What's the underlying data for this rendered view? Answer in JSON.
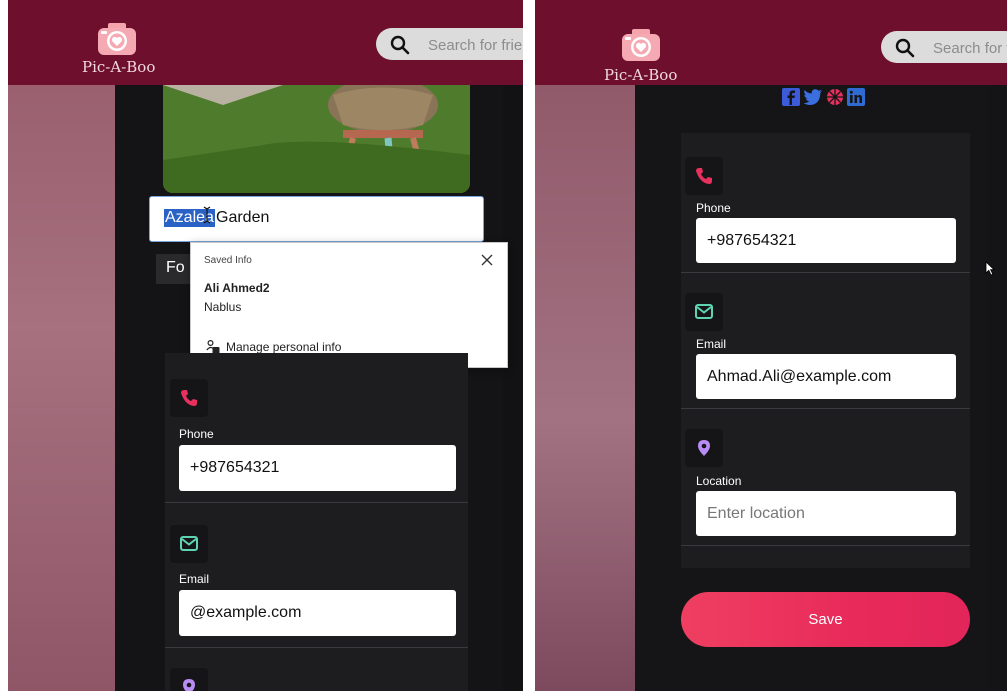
{
  "app": {
    "name": "Pic-A-Boo",
    "search_placeholder": "Search for friends"
  },
  "left": {
    "photo_alt": "garden photo",
    "name_field": {
      "selected_text": "Azalea",
      "rest_text": " Garden"
    },
    "partial_text": "Fo",
    "autofill": {
      "title": "Saved Info",
      "name": "Ali Ahmed2",
      "city": "Nablus",
      "manage_label": "Manage personal info"
    },
    "phone": {
      "label": "Phone",
      "value": "+987654321"
    },
    "email": {
      "label": "Email",
      "value": "@example.com"
    }
  },
  "right": {
    "phone": {
      "label": "Phone",
      "value": "+987654321"
    },
    "email": {
      "label": "Email",
      "value": "Ahmad.Ali@example.com"
    },
    "location": {
      "label": "Location",
      "placeholder": "Enter location",
      "value": ""
    },
    "save_label": "Save"
  },
  "colors": {
    "header": "#6d0f2d",
    "phone_icon": "#e8305e",
    "email_icon": "#5fd4b0",
    "location_icon": "#b98cf5",
    "save_button": "#e82a5a"
  },
  "icons": [
    "camera-logo-icon",
    "search-icon",
    "close-icon",
    "manage-info-icon",
    "phone-icon",
    "email-icon",
    "location-icon",
    "facebook-icon",
    "twitter-icon",
    "dribbble-icon",
    "linkedin-icon",
    "mouse-cursor-icon",
    "text-cursor-icon"
  ]
}
